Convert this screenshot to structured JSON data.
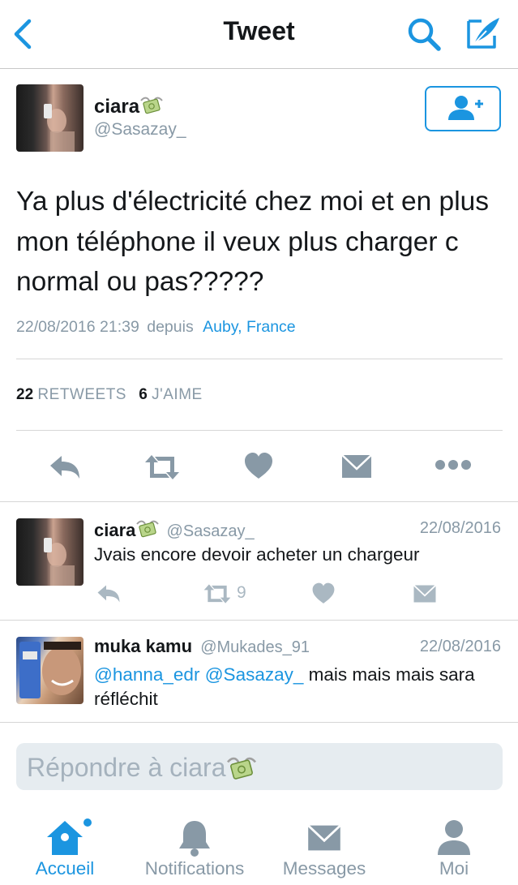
{
  "header": {
    "title": "Tweet"
  },
  "tweet": {
    "author_name": "ciara",
    "author_handle": "@Sasazay_",
    "text": "Ya plus d'électricité chez moi et en plus mon téléphone il veux plus charger c normal ou pas?????",
    "timestamp": "22/08/2016 21:39",
    "source_prefix": "depuis",
    "location": "Auby, France",
    "retweets_count": "22",
    "retweets_label": "RETWEETS",
    "likes_count": "6",
    "likes_label": "J'AIME"
  },
  "replies": [
    {
      "name": "ciara",
      "handle": "@Sasazay_",
      "date": "22/08/2016",
      "text": "Jvais encore devoir acheter un chargeur",
      "retweet_count": "9"
    },
    {
      "name": "muka kamu",
      "handle": "@Mukades_91",
      "date": "22/08/2016",
      "mention1": "@hanna_edr",
      "mention2": "@Sasazay_",
      "text_after": "mais mais mais sara",
      "text_line2": "réfléchit"
    }
  ],
  "reply_box": {
    "placeholder": "Répondre à ciara"
  },
  "tab_bar": {
    "tabs": [
      {
        "label": "Accueil",
        "icon": "home-icon",
        "active": true
      },
      {
        "label": "Notifications",
        "icon": "bell-icon",
        "active": false
      },
      {
        "label": "Messages",
        "icon": "envelope-icon",
        "active": false
      },
      {
        "label": "Moi",
        "icon": "person-icon",
        "active": false
      }
    ]
  },
  "colors": {
    "accent": "#1b95e0",
    "icon_gray": "#aab8c2",
    "text_gray": "#8899a6",
    "divider": "#d6d6d6"
  }
}
